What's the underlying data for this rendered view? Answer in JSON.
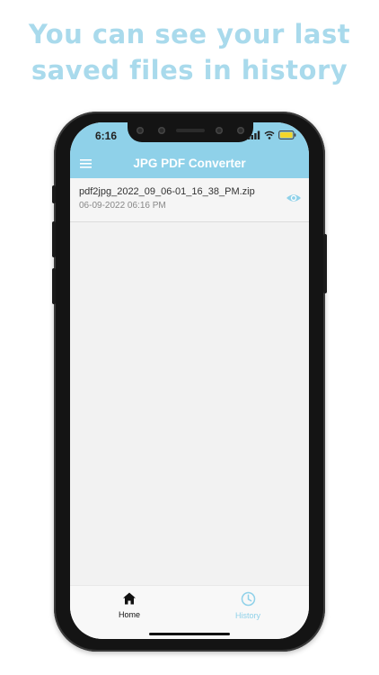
{
  "headline": {
    "line1": "You can see your last",
    "line2": "saved files in history"
  },
  "status_bar": {
    "time": "6:16",
    "icons": [
      "cellular-signal-icon",
      "wifi-icon",
      "battery-icon"
    ]
  },
  "app_bar": {
    "title": "JPG PDF Converter",
    "menu_icon": "hamburger-menu-icon",
    "background": "#8fd1e9"
  },
  "history": {
    "items": [
      {
        "file_name": "pdf2jpg_2022_09_06-01_16_38_PM.zip",
        "date": "06-09-2022 06:16 PM",
        "action_icon": "eye-icon"
      }
    ]
  },
  "bottom_nav": {
    "items": [
      {
        "label": "Home",
        "icon": "home-icon",
        "active": true,
        "color": "#111111"
      },
      {
        "label": "History",
        "icon": "clock-icon",
        "active": false,
        "color": "#8fd1e9"
      }
    ]
  },
  "colors": {
    "accent": "#8fd1e9",
    "headline": "#a9daec",
    "phone_frame": "#141414",
    "screen_background": "#f2f2f2"
  }
}
